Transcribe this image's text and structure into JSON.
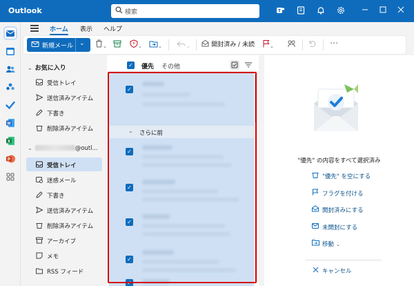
{
  "app": {
    "title": "Outlook"
  },
  "search": {
    "placeholder": "検索"
  },
  "menu": {
    "tabs": [
      "ホーム",
      "表示",
      "ヘルプ"
    ]
  },
  "ribbon": {
    "new_mail": "新規メール",
    "mark_read_unread": "開封済み / 未読"
  },
  "folders": {
    "favorites_header": "お気に入り",
    "favorites": [
      "受信トレイ",
      "送信済みアイテム",
      "下書き",
      "削除済みアイテム"
    ],
    "account_suffix": "@outl...",
    "account_folders": [
      "受信トレイ",
      "迷惑メール",
      "下書き",
      "送信済みアイテム",
      "削除済みアイテム",
      "アーカイブ",
      "メモ",
      "RSS フィード"
    ]
  },
  "list": {
    "focused_tab": "優先",
    "other_tab": "その他",
    "section_label": "さらに前"
  },
  "reading": {
    "title": "\"優先\" の内容をすべて選択済み",
    "actions": [
      "\"優先\" を空にする",
      "フラグを付ける",
      "開封済みにする",
      "未開封にする",
      "移動"
    ],
    "cancel": "キャンセル"
  },
  "colors": {
    "brand": "#0f6cbd",
    "selection": "#cfe0f4",
    "highlight": "#d40000"
  }
}
